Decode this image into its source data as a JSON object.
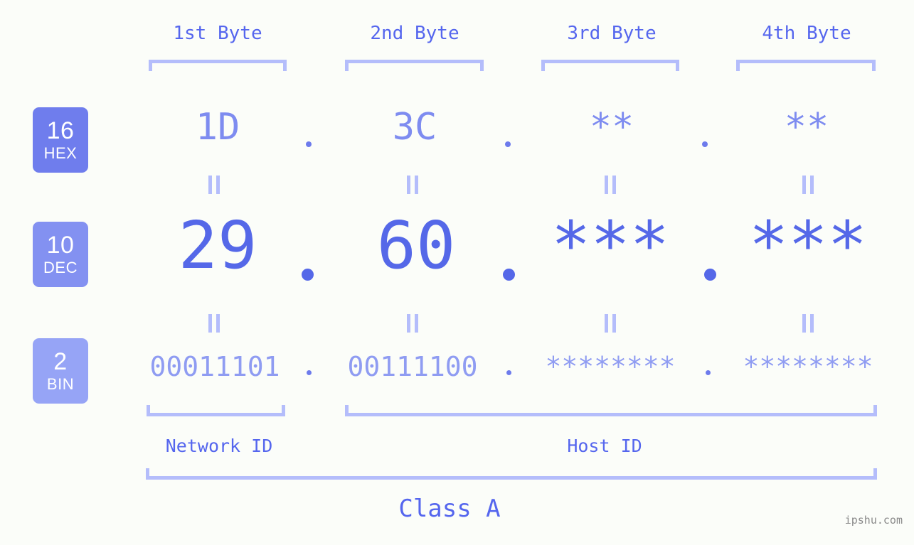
{
  "background_color": "#fbfdf9",
  "accent_color": "#5568e8",
  "accent_light": "#b4bdfb",
  "byte_headers": [
    {
      "label": "1st Byte"
    },
    {
      "label": "2nd Byte"
    },
    {
      "label": "3rd Byte"
    },
    {
      "label": "4th Byte"
    }
  ],
  "bases": [
    {
      "number": "16",
      "name": "HEX",
      "color": "#6f7ded"
    },
    {
      "number": "10",
      "name": "DEC",
      "color": "#8391f1"
    },
    {
      "number": "2",
      "name": "BIN",
      "color": "#96a4f6"
    }
  ],
  "rows": {
    "hex": {
      "base_number": "16",
      "base_name": "HEX",
      "values": [
        "1D",
        "3C",
        "**",
        "**"
      ],
      "separator": "."
    },
    "dec": {
      "base_number": "10",
      "base_name": "DEC",
      "values": [
        "29",
        "60",
        "***",
        "***"
      ],
      "separator": "."
    },
    "bin": {
      "base_number": "2",
      "base_name": "BIN",
      "values": [
        "00011101",
        "00111100",
        "********",
        "********"
      ],
      "separator": "."
    }
  },
  "equivalence_symbol": "=",
  "regions": [
    {
      "label": "Network ID"
    },
    {
      "label": "Host ID"
    }
  ],
  "class": {
    "label": "Class A"
  },
  "watermark": {
    "text": "ipshu.com"
  }
}
